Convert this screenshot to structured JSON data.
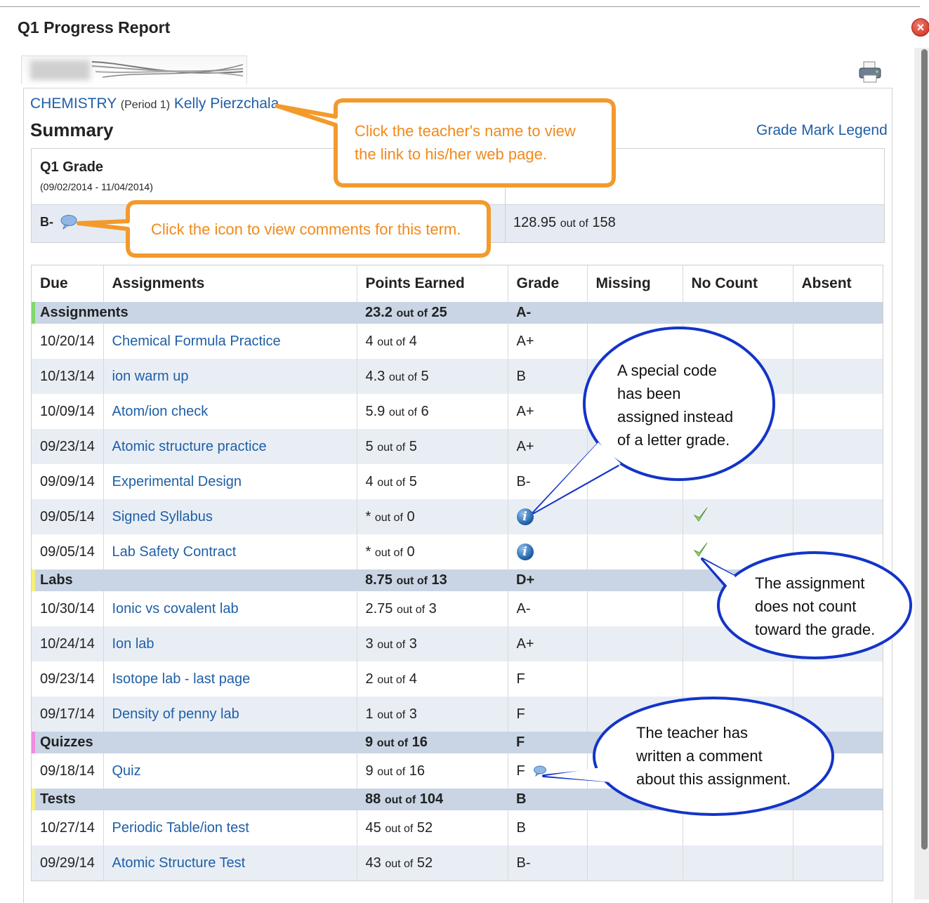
{
  "window": {
    "title": "Q1 Progress Report"
  },
  "course": {
    "name": "CHEMISTRY",
    "period": "(Period 1)",
    "teacher": "Kelly Pierzchala"
  },
  "summary": {
    "heading": "Summary",
    "legend_link": "Grade Mark Legend",
    "term_label": "Q1 Grade",
    "term_dates": "(09/02/2014 - 11/04/2014)",
    "term_grade": "B-",
    "points_earned": "128.95",
    "points_of": "out of",
    "points_possible": "158"
  },
  "table": {
    "headers": [
      "Due",
      "Assignments",
      "Points Earned",
      "Grade",
      "Missing",
      "No Count",
      "Absent"
    ],
    "out_of": "out of",
    "categories": [
      {
        "name": "Assignments",
        "earned": "23.2",
        "possible": "25",
        "grade": "A-",
        "color": "#7ed96f"
      },
      {
        "name": "Labs",
        "earned": "8.75",
        "possible": "13",
        "grade": "D+",
        "color": "#f5ef7a"
      },
      {
        "name": "Quizzes",
        "earned": "9",
        "possible": "16",
        "grade": "F",
        "color": "#f08ce0"
      },
      {
        "name": "Tests",
        "earned": "88",
        "possible": "104",
        "grade": "B",
        "color": "#f5ef7a"
      }
    ],
    "rows": [
      {
        "due": "10/20/14",
        "name": "Chemical Formula Practice",
        "earned": "4",
        "possible": "4",
        "grade": "A+"
      },
      {
        "due": "10/13/14",
        "name": "ion warm up",
        "earned": "4.3",
        "possible": "5",
        "grade": "B"
      },
      {
        "due": "10/09/14",
        "name": "Atom/ion check",
        "earned": "5.9",
        "possible": "6",
        "grade": "A+"
      },
      {
        "due": "09/23/14",
        "name": "Atomic structure practice",
        "earned": "5",
        "possible": "5",
        "grade": "A+"
      },
      {
        "due": "09/09/14",
        "name": "Experimental Design",
        "earned": "4",
        "possible": "5",
        "grade": "B-"
      },
      {
        "due": "09/05/14",
        "name": "Signed Syllabus",
        "earned": "*",
        "possible": "0",
        "grade": ""
      },
      {
        "due": "09/05/14",
        "name": "Lab Safety Contract",
        "earned": "*",
        "possible": "0",
        "grade": ""
      },
      {
        "due": "10/30/14",
        "name": "Ionic vs covalent lab",
        "earned": "2.75",
        "possible": "3",
        "grade": "A-"
      },
      {
        "due": "10/24/14",
        "name": "Ion lab",
        "earned": "3",
        "possible": "3",
        "grade": "A+"
      },
      {
        "due": "09/23/14",
        "name": "Isotope lab - last page",
        "earned": "2",
        "possible": "4",
        "grade": "F"
      },
      {
        "due": "09/17/14",
        "name": "Density of penny lab",
        "earned": "1",
        "possible": "3",
        "grade": "F"
      },
      {
        "due": "09/18/14",
        "name": "Quiz",
        "earned": "9",
        "possible": "16",
        "grade": "F"
      },
      {
        "due": "10/27/14",
        "name": "Periodic Table/ion test",
        "earned": "45",
        "possible": "52",
        "grade": "B"
      },
      {
        "due": "09/29/14",
        "name": "Atomic Structure Test",
        "earned": "43",
        "possible": "52",
        "grade": "B-"
      }
    ]
  },
  "callouts": {
    "teacher_line1": "Click the teacher's name to view",
    "teacher_line2": "the link to his/her web page.",
    "term_comment": "Click the icon to view comments for this term.",
    "special_code_line1": "A special code",
    "special_code_line2": "has been",
    "special_code_line3": "assigned instead",
    "special_code_line4": "of a letter grade.",
    "no_count_line1": "The assignment",
    "no_count_line2": "does not count",
    "no_count_line3": "toward the grade.",
    "comment_line1": "The teacher has",
    "comment_line2": "written a comment",
    "comment_line3": "about this assignment."
  },
  "icons": {
    "close": "close-icon",
    "printer": "printer-icon",
    "comment": "comment-bubble-icon",
    "info": "info-icon",
    "check": "checkmark-icon"
  }
}
